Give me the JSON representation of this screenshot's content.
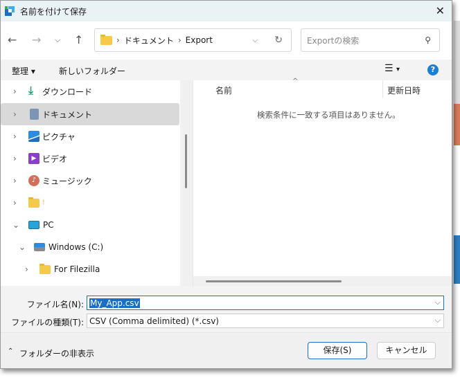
{
  "title": "名前を付けて保存",
  "address": {
    "crumbs": [
      "ドキュメント",
      "Export"
    ],
    "search_placeholder": "Exportの検索"
  },
  "toolbar": {
    "organize": "整理",
    "new_folder": "新しいフォルダー"
  },
  "nav": [
    {
      "label": "ダウンロード",
      "icon": "download-icon"
    },
    {
      "label": "ドキュメント",
      "icon": "documents-icon",
      "selected": true
    },
    {
      "label": "ピクチャ",
      "icon": "pictures-icon"
    },
    {
      "label": "ビデオ",
      "icon": "videos-icon"
    },
    {
      "label": "ミュージック",
      "icon": "music-icon"
    },
    {
      "label": "!",
      "icon": "folder-icon"
    },
    {
      "label": "PC",
      "icon": "pc-icon"
    },
    {
      "label": "Windows (C:)",
      "icon": "drive-icon"
    },
    {
      "label": "For Filezilla",
      "icon": "folder-icon"
    }
  ],
  "list": {
    "col_name": "名前",
    "col_date": "更新日時",
    "empty": "検索条件に一致する項目はありません。"
  },
  "form": {
    "filename_label": "ファイル名(N):",
    "filename": "My_App.csv",
    "type_label": "ファイルの種類(T):",
    "type": "CSV (Comma delimited) (*.csv)"
  },
  "footer": {
    "hide_folders": "フォルダーの非表示",
    "save": "保存(S)",
    "cancel": "キャンセル"
  }
}
